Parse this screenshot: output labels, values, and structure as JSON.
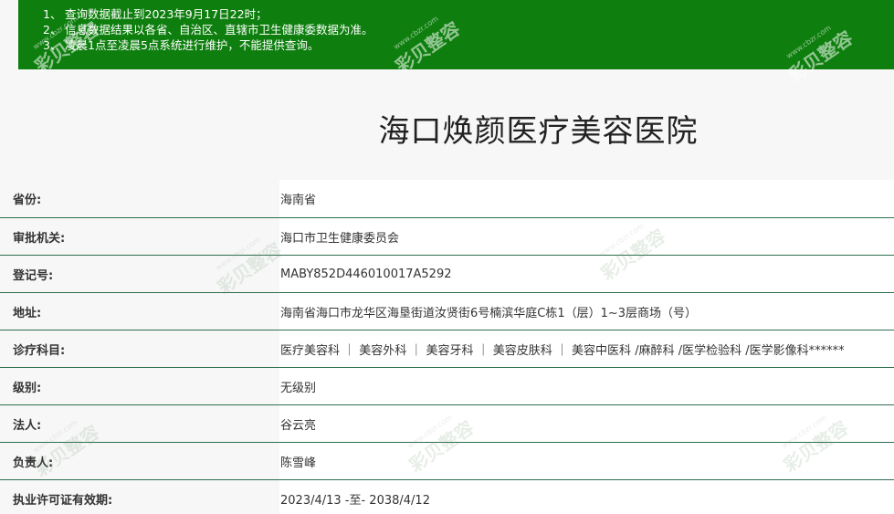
{
  "notice": {
    "lines": [
      {
        "num": "1、",
        "text": "查询数据截止到2023年9月17日22时；"
      },
      {
        "num": "2、",
        "text": "信息数据结果以各省、自治区、直辖市卫生健康委数据为准。"
      },
      {
        "num": "3、",
        "text": "凌晨1点至凌晨5点系统进行维护，不能提供查询。"
      }
    ]
  },
  "title": "海口焕颜医疗美容医院",
  "info": {
    "rows": [
      {
        "label": "省份:",
        "value": "海南省"
      },
      {
        "label": "审批机关:",
        "value": "海口市卫生健康委员会"
      },
      {
        "label": "登记号:",
        "value": "MABY852D446010017A5292"
      },
      {
        "label": "地址:",
        "value": "海南省海口市龙华区海垦街道汝贤街6号楠滨华庭C栋1（层）1~3层商场（号）"
      },
      {
        "label": "诊疗科目:",
        "value": "医疗美容科 ｜ 美容外科 ｜ 美容牙科 ｜ 美容皮肤科 ｜ 美容中医科 /麻醉科 /医学检验科 /医学影像科******"
      },
      {
        "label": "级别:",
        "value": "无级别"
      },
      {
        "label": "法人:",
        "value": "谷云亮"
      },
      {
        "label": "负责人:",
        "value": "陈雪峰"
      },
      {
        "label": "执业许可证有效期:",
        "value": "2023/4/13 -至- 2038/4/12"
      }
    ]
  },
  "watermark": {
    "text": "彩贝整容",
    "url": "www.cbzr.com"
  },
  "colors": {
    "banner": "#0e7f0e",
    "divider": "#2f6e4f"
  }
}
